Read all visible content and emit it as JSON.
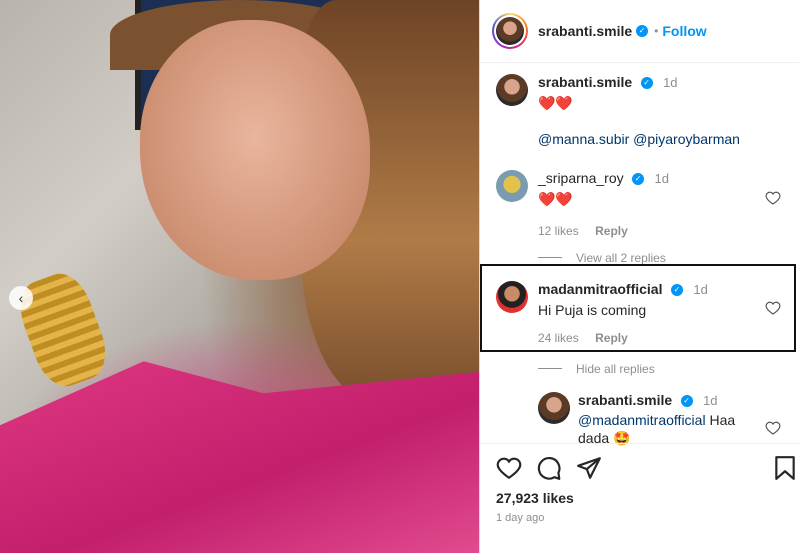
{
  "post": {
    "author": "srabanti.smile",
    "follow_label": "Follow",
    "dot": "•",
    "likes": "27,923 likes",
    "date": "1 day ago"
  },
  "comments": [
    {
      "user": "srabanti.smile",
      "time": "1d",
      "text": "❤️❤️",
      "mentions": "@manna.subir @piyaroybarman"
    },
    {
      "user": "_sriparna_roy",
      "time": "1d",
      "text": "❤️❤️",
      "likes": "12 likes",
      "reply": "Reply",
      "view_replies": "View all 2 replies"
    },
    {
      "user": "madanmitraofficial",
      "time": "1d",
      "text": "Hi Puja is coming",
      "likes": "24 likes",
      "reply": "Reply",
      "hide_replies": "Hide all replies"
    },
    {
      "user": "srabanti.smile",
      "time": "1d",
      "mention": "@madanmitraofficial",
      "text": " Haa dada 🤩"
    }
  ],
  "icons": [
    "heart-icon",
    "comment-icon",
    "share-icon",
    "save-icon",
    "chevron-left-icon",
    "verified-icon"
  ],
  "colors": {
    "link": "#0095f6",
    "mention": "#00376b",
    "muted": "#8e8e8e"
  }
}
